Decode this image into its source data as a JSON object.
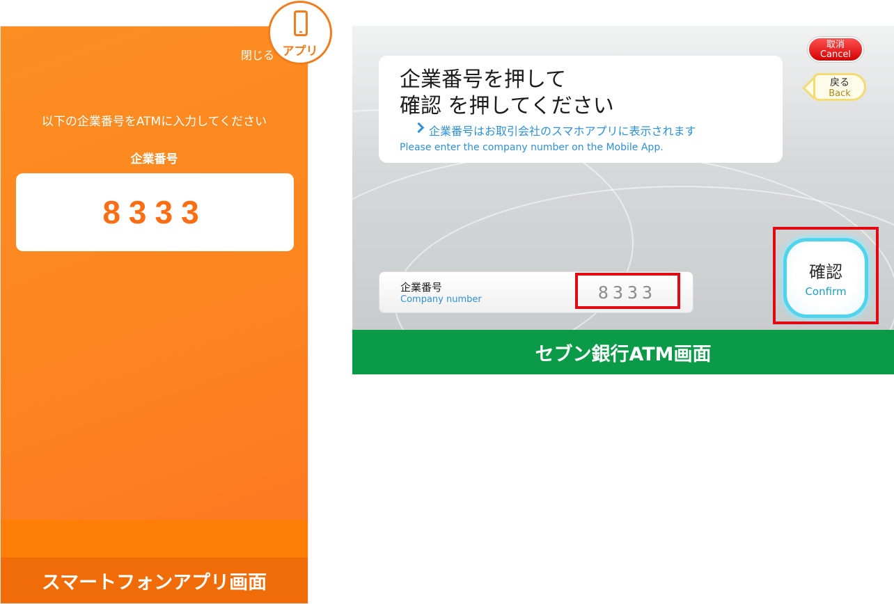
{
  "phone": {
    "close_label": "閉じる",
    "instruction": "以下の企業番号をATMに入力してください",
    "number_label": "企業番号",
    "company_number": "8333",
    "caption": "スマートフォンアプリ画面"
  },
  "app_badge": {
    "label": "アプリ",
    "icon": "smartphone-icon",
    "color": "#f07c1d"
  },
  "atm": {
    "title_line1": "企業番号を押して",
    "title_line2": "確認 を押してください",
    "hint": "企業番号はお取引会社のスマホアプリに表示されます",
    "hint_en": "Please enter the company number on the Mobile App.",
    "cancel_label": "取消",
    "cancel_label_en": "Cancel",
    "back_label": "戻る",
    "back_label_en": "Back",
    "field_label": "企業番号",
    "field_label_en": "Company number",
    "field_value": "8333",
    "confirm_label": "確認",
    "confirm_label_en": "Confirm",
    "caption": "セブン銀行ATM画面"
  },
  "colors": {
    "phone_orange": "#fd8420",
    "atm_green": "#0b9b48",
    "highlight_red": "#e00a14",
    "link_blue": "#2f8fd7"
  }
}
